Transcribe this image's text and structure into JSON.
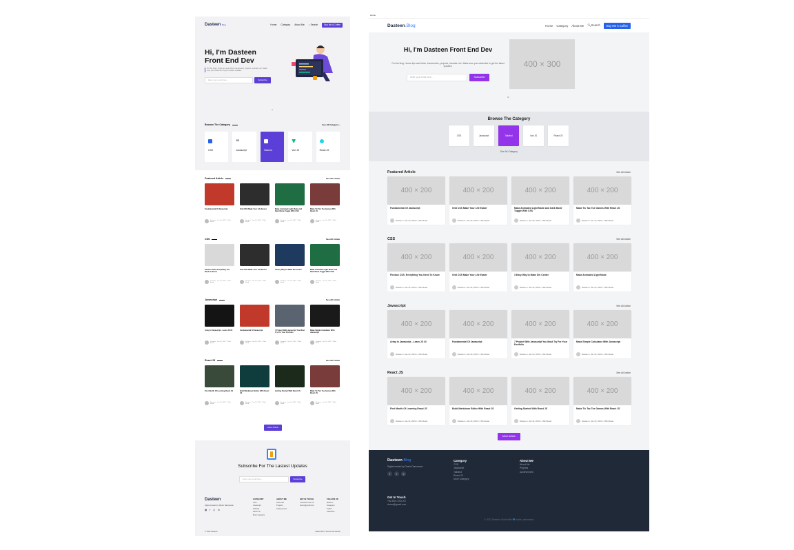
{
  "left": {
    "nav": {
      "logo": "Dasteen",
      "logo_small": "Blog",
      "links": [
        "Home",
        "Category",
        "About Me"
      ],
      "search": "Search",
      "button": "Buy Me A Coffee"
    },
    "hero": {
      "title": "Hi, I'm Dasteen Front End Dev",
      "desc": "On this blog I share tips and tricks, frameworks, projects, tutorials, etc. Make sure you subscribe to get the latest updates.",
      "input_placeholder": "Enter your email here...",
      "subscribe": "Subscribe"
    },
    "category": {
      "title": "Browse The Category",
      "see_all": "See All Category",
      "items": [
        {
          "name": "CSS",
          "color": "#2563eb"
        },
        {
          "name": "Javascript",
          "color": "#111111"
        },
        {
          "name": "Tailwind",
          "color": "#38bdf8"
        },
        {
          "name": "Vue JS",
          "color": "#10b981"
        },
        {
          "name": "React JS",
          "color": "#22d3ee"
        }
      ]
    },
    "sections": [
      {
        "title": "Featured Article",
        "see": "See All Article",
        "cards": [
          {
            "title": "Fundamental Of Javascript",
            "img": "#c0392b",
            "meta": "Dasteen · Jan 10, 2022 · 3 Min Read"
          },
          {
            "title": "Grid CSS Make Your Life Easier",
            "img": "#2d2d2d",
            "meta": "Dasteen · Jan 10, 2022 · 3 Min Read"
          },
          {
            "title": "Make Animated Light Mode And Dark Mode Toggle With CSS",
            "img": "#1f6e43",
            "meta": "Dasteen · Jan 10, 2022 · 3 Min Read"
          },
          {
            "title": "Make Tic Tac Toe Games With React JS",
            "img": "#7a3b3b",
            "meta": "Dasteen · Jan 10, 2022 · 3 Min Read"
          }
        ]
      },
      {
        "title": "CSS",
        "see": "See All Article",
        "cards": [
          {
            "title": "Flexbox CSS: Everything You Need To Know",
            "img": "#d9d9d9",
            "meta": "Dasteen · Jan 10, 2022 · 3 Min Read"
          },
          {
            "title": "Grid CSS Make Your Life Easier",
            "img": "#2d2d2d",
            "meta": "Dasteen · Jan 10, 2022 · 3 Min Read"
          },
          {
            "title": "3 Easy Way To Make Div Center",
            "img": "#1e3a5f",
            "meta": "Dasteen · Jan 10, 2022 · 3 Min Read"
          },
          {
            "title": "Make Animated Light Mode And Dark Mode Toggle With CSS",
            "img": "#1f6e43",
            "meta": "Dasteen · Jan 10, 2022 · 3 Min Read"
          }
        ]
      },
      {
        "title": "Javascript",
        "see": "See All Article",
        "cards": [
          {
            "title": "Array In Javascript - Learn JS #3",
            "img": "#141414",
            "meta": "Dasteen · Jan 10, 2022 · 3 Min Read"
          },
          {
            "title": "Fundamental Of Javascript",
            "img": "#c0392b",
            "meta": "Dasteen · Jan 10, 2022 · 3 Min Read"
          },
          {
            "title": "7 Project With Javascript You Must Try For Your Portfolio",
            "img": "#5a6470",
            "meta": "Dasteen · Jan 10, 2022 · 3 Min Read"
          },
          {
            "title": "Make Simple Calculator With Javascript",
            "img": "#1a1a1a",
            "meta": "Dasteen · Jan 10, 2022 · 3 Min Read"
          }
        ]
      },
      {
        "title": "React JS",
        "see": "See All Article",
        "cards": [
          {
            "title": "First Month Of Learning React JS",
            "img": "#3a4a3a",
            "meta": "Dasteen · Jan 10, 2022 · 3 Min Read"
          },
          {
            "title": "Build Markdown Editor With React JS",
            "img": "#0f3d3e",
            "meta": "Dasteen · Jan 10, 2022 · 3 Min Read"
          },
          {
            "title": "Getting Started With React JS",
            "img": "#1b2a1b",
            "meta": "Dasteen · Jan 10, 2022 · 3 Min Read"
          },
          {
            "title": "Make Tic Tac Toe Games With React JS",
            "img": "#7a3b3b",
            "meta": "Dasteen · Jan 10, 2022 · 3 Min Read"
          }
        ]
      }
    ],
    "more_article": "More Article",
    "subscribe": {
      "title": "Subscribe For The Lastest Updates",
      "placeholder": "Enter your email here...",
      "button": "Subscribe"
    },
    "footer": {
      "logo": "Dasteen",
      "desc": "Digital created by Dustin Damnawan",
      "social": [
        "▦",
        "f",
        "◎",
        "in"
      ],
      "cols": [
        {
          "h": "CATEGORY",
          "items": [
            "CSS",
            "Javascript",
            "Tailwind",
            "React JS",
            "More Category"
          ]
        },
        {
          "h": "ABOUT ME",
          "items": [
            "About Me",
            "Projects",
            "Achievement"
          ]
        },
        {
          "h": "GET IN TOUCH",
          "items": [
            "+62-8XX-XXX-XX",
            "demo@gmail.com"
          ]
        },
        {
          "h": "FOLLOW US",
          "items": [
            "Medium",
            "Instagram",
            "Twitter",
            "Facebook"
          ]
        }
      ],
      "copyright": "© 2022 Dasteen",
      "made": "Made With ♥ Dustin Damnawan"
    }
  },
  "right": {
    "tab": "Home",
    "nav": {
      "logo": "Dasteen",
      "logo_b": ".Blog",
      "links": [
        "Home",
        "Category",
        "About Me"
      ],
      "search": "Search",
      "button": "Buy Me A Coffee"
    },
    "hero": {
      "title": "Hi, I'm Dasteen Front End Dev",
      "desc": "On this blog I share tips and tricks, frameworks, projects, tutorials, etc. Make sure you subscribe to get the latest updates.",
      "placeholder": "Enter your email here...",
      "subscribe": "Subscribe",
      "image": "400 × 300"
    },
    "category": {
      "title": "Browse The Category",
      "items": [
        "CSS",
        "Javascript",
        "Tailwind",
        "Vue JS",
        "React JS"
      ],
      "active": "Tailwind",
      "see_all": "See All Category"
    },
    "sections": [
      {
        "title": "Featured Article",
        "see": "See All Article",
        "cards": [
          {
            "title": "Fundamental Of Javascript",
            "meta": "Dasteen • Jan 10, 2022 • 3 Min Read"
          },
          {
            "title": "Grid CSS Make Your Life Easier",
            "meta": "Dasteen • Jan 10, 2022 • 3 Min Read"
          },
          {
            "title": "Make Animated Light Mode And Dark Mode Toggle With CSS",
            "meta": "Dasteen • Jan 10, 2022 • 3 Min Read"
          },
          {
            "title": "Make Tic Tac Toe Games With React JS",
            "meta": "Dasteen • Jan 10, 2022 • 3 Min Read"
          }
        ]
      },
      {
        "title": "CSS",
        "see": "See All Article",
        "cards": [
          {
            "title": "Flexbox CSS: Everything You Need To Know",
            "meta": "Dasteen • Jan 10, 2022 • 3 Min Read"
          },
          {
            "title": "Grid CSS Make Your Life Easier",
            "meta": "Dasteen • Jan 10, 2022 • 3 Min Read"
          },
          {
            "title": "3 Easy Way to Make Div Center",
            "meta": "Dasteen • Jan 10, 2022 • 3 Min Read"
          },
          {
            "title": "Make Animated Light Mode",
            "meta": "Dasteen • Jan 10, 2022 • 3 Min Read"
          }
        ]
      },
      {
        "title": "Javascript",
        "see": "See All Article",
        "cards": [
          {
            "title": "Array In Javascript - Learn JS #3",
            "meta": "Dasteen • Jan 10, 2022 • 3 Min Read"
          },
          {
            "title": "Fundamental Of Javascript",
            "meta": "Dasteen • Jan 10, 2022 • 3 Min Read"
          },
          {
            "title": "7 Project With Javascript You Must Try For Your Portfolio",
            "meta": "Dasteen • Jan 10, 2022 • 3 Min Read"
          },
          {
            "title": "Make Simple Calculator With Javascript",
            "meta": "Dasteen • Jan 10, 2022 • 3 Min Read"
          }
        ]
      },
      {
        "title": "React JS",
        "see": "See All Article",
        "cards": [
          {
            "title": "First Month Of Learning React JS",
            "meta": "Dasteen • Jan 10, 2022 • 3 Min Read"
          },
          {
            "title": "Build Markdown Editor With React JS",
            "meta": "Dasteen • Jan 10, 2022 • 3 Min Read"
          },
          {
            "title": "Getting Started With React JS",
            "meta": "Dasteen • Jan 10, 2022 • 3 Min Read"
          },
          {
            "title": "Make Tic Tac Toe Games With React JS",
            "meta": "Dasteen • Jan 10, 2022 • 3 Min Read"
          }
        ]
      }
    ],
    "card_image": "400 × 200",
    "more_article": "More Article",
    "footer": {
      "logo": "Dasteen",
      "logo_b": ".Blog",
      "desc": "Digital created by Dustin Damnawan",
      "social": [
        "f",
        "t",
        "◎"
      ],
      "cols": [
        {
          "h": "Category",
          "items": [
            "CSS",
            "Javascript",
            "Tailwind",
            "React JS",
            "More Category"
          ]
        },
        {
          "h": "About Me",
          "items": [
            "About Me",
            "Projects",
            "Achievement"
          ]
        }
      ],
      "touch": {
        "h": "Get In Touch",
        "items": [
          "+62-8XX-XXX-XX",
          "demo@gmail.com"
        ]
      },
      "copyright": "© 2022 Dasteen. Made With 💙 dustin_damnawan"
    }
  }
}
